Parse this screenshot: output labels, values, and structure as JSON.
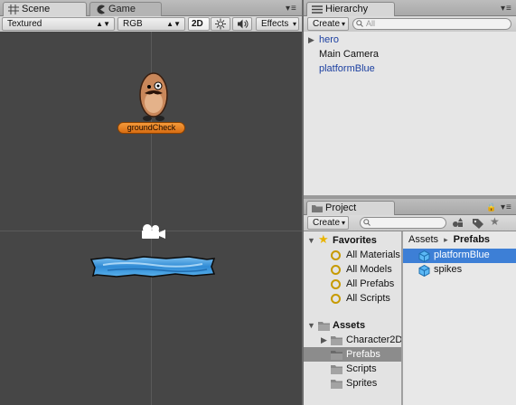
{
  "scene_panel": {
    "tabs": [
      {
        "label": "Scene",
        "active": true
      },
      {
        "label": "Game",
        "active": false
      }
    ],
    "toolbar": {
      "render_mode": "Textured",
      "color_mode": "RGB",
      "mode_2d": "2D",
      "effects": "Effects"
    },
    "objects": {
      "ground_check_label": "groundCheck"
    }
  },
  "hierarchy": {
    "title": "Hierarchy",
    "create_label": "Create",
    "search_placeholder": "All",
    "items": [
      {
        "label": "hero",
        "prefab": true,
        "expandable": true
      },
      {
        "label": "Main Camera",
        "prefab": false,
        "expandable": false
      },
      {
        "label": "platformBlue",
        "prefab": true,
        "expandable": false
      }
    ]
  },
  "project": {
    "title": "Project",
    "create_label": "Create",
    "favorites": {
      "label": "Favorites",
      "items": [
        "All Materials",
        "All Models",
        "All Prefabs",
        "All Scripts"
      ]
    },
    "assets": {
      "label": "Assets",
      "folders": [
        {
          "label": "Character2D",
          "expandable": true,
          "selected": false
        },
        {
          "label": "Prefabs",
          "expandable": false,
          "selected": true
        },
        {
          "label": "Scripts",
          "expandable": false,
          "selected": false
        },
        {
          "label": "Sprites",
          "expandable": false,
          "selected": false
        }
      ]
    },
    "breadcrumb": {
      "root": "Assets",
      "separator": "▸",
      "current": "Prefabs"
    },
    "files": [
      {
        "label": "platformBlue",
        "selected": true
      },
      {
        "label": "spikes",
        "selected": false
      }
    ]
  },
  "colors": {
    "scene_bg": "#464646",
    "selection_blue": "#3d7fd6",
    "prefab_text": "#1b3fa0",
    "ground_check": "#e8822a"
  }
}
